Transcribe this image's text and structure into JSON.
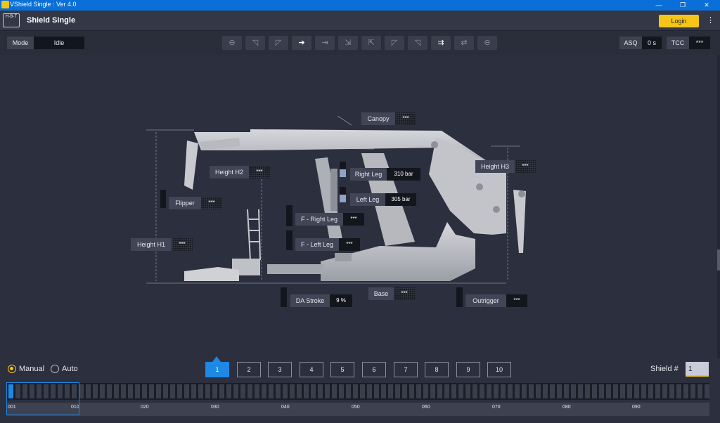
{
  "window": {
    "title": "VShield Single : Ver 4.0",
    "controls": [
      "—",
      "❐",
      "✕"
    ]
  },
  "header": {
    "logo": "H·B·T",
    "app_name": "Shield Single",
    "login_label": "Login",
    "menu_icon": "⋮"
  },
  "toolbar": {
    "mode_label": "Mode",
    "mode_value": "Idle",
    "mode_buttons": [
      {
        "icon": "stop-icon",
        "glyph": "⊖",
        "active": false
      },
      {
        "icon": "mode-icon-2",
        "glyph": "◹",
        "active": false
      },
      {
        "icon": "mode-icon-3",
        "glyph": "◸",
        "active": false
      },
      {
        "icon": "mode-icon-4",
        "glyph": "➔",
        "active": true
      },
      {
        "icon": "mode-icon-5",
        "glyph": "⇥",
        "active": false
      },
      {
        "icon": "mode-icon-6",
        "glyph": "⇲",
        "active": false
      },
      {
        "icon": "mode-icon-7",
        "glyph": "⇱",
        "active": false
      },
      {
        "icon": "mode-icon-8",
        "glyph": "◸",
        "active": false
      },
      {
        "icon": "mode-icon-9",
        "glyph": "◹",
        "active": false
      },
      {
        "icon": "mode-icon-10",
        "glyph": "⇉",
        "active": true
      },
      {
        "icon": "mode-icon-11",
        "glyph": "⇄",
        "active": false
      },
      {
        "icon": "stop-icon-2",
        "glyph": "⊖",
        "active": false
      }
    ],
    "asq_label": "ASQ",
    "asq_value": "0 s",
    "tcc_label": "TCC",
    "tcc_value": "***"
  },
  "sensors": {
    "canopy": {
      "label": "Canopy",
      "value": "***"
    },
    "height_h2": {
      "label": "Height H2",
      "value": "***"
    },
    "right_leg": {
      "label": "Right Leg",
      "value": "310 bar"
    },
    "left_leg": {
      "label": "Left Leg",
      "value": "305 bar"
    },
    "height_h3": {
      "label": "Height H3",
      "value": "***"
    },
    "flipper": {
      "label": "Flipper",
      "value": "***"
    },
    "f_right_leg": {
      "label": "F - Right Leg",
      "value": "***"
    },
    "f_left_leg": {
      "label": "F - Left Leg",
      "value": "***"
    },
    "height_h1": {
      "label": "Height H1",
      "value": "***"
    },
    "base": {
      "label": "Base",
      "value": "***"
    },
    "da_stroke": {
      "label": "DA Stroke",
      "value": "9 %"
    },
    "outrigger": {
      "label": "Outrigger",
      "value": "***"
    }
  },
  "bottom": {
    "manual_label": "Manual",
    "auto_label": "Auto",
    "selected_mode": "Manual",
    "pages": [
      "1",
      "2",
      "3",
      "4",
      "5",
      "6",
      "7",
      "8",
      "9",
      "10"
    ],
    "active_page": "1",
    "shield_label": "Shield #",
    "shield_value": "1",
    "scale_ticks": [
      "001",
      "010",
      "020",
      "030",
      "040",
      "050",
      "060",
      "070",
      "080",
      "090"
    ]
  },
  "colors": {
    "accent": "#1e88e5",
    "brand": "#f5c518",
    "titlebar": "#0a6fd8",
    "background": "#2c2f3d"
  }
}
